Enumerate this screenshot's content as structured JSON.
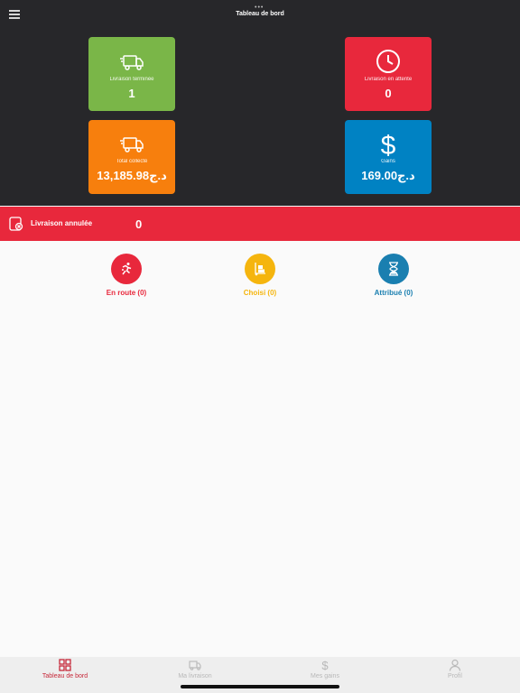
{
  "header": {
    "title": "Tableau de bord",
    "menu_icon": "hamburger-icon",
    "dots": "•••"
  },
  "cards": {
    "completed": {
      "label": "Livraison terminée",
      "value": "1",
      "color": "#7ab648",
      "icon": "delivery-truck-icon"
    },
    "pending": {
      "label": "Livraison en attente",
      "value": "0",
      "color": "#e8283c",
      "icon": "clock-icon"
    },
    "collected": {
      "label": "Total collecté",
      "value": "13,185.98د.ج",
      "color": "#f77f0d",
      "icon": "delivery-truck-icon"
    },
    "earnings": {
      "label": "Gains",
      "value": "169.00د.ج",
      "color": "#0082c3",
      "icon": "dollar-icon"
    }
  },
  "cancelled": {
    "label": "Livraison annulée",
    "value": "0",
    "color": "#e8283c",
    "icon": "cancel-box-icon"
  },
  "statuses": {
    "en_route": {
      "label": "En route (0)",
      "color": "#e8283c",
      "icon": "running-person-icon"
    },
    "choisi": {
      "label": "Choisi (0)",
      "color": "#f5b50e",
      "icon": "hand-truck-icon"
    },
    "attribue": {
      "label": "Attribué (0)",
      "color": "#1a7fb0",
      "icon": "hourglass-icon"
    }
  },
  "nav": {
    "items": [
      {
        "label": "Tableau de bord",
        "icon": "dashboard-grid-icon",
        "active": true
      },
      {
        "label": "Ma livraison",
        "icon": "truck-icon",
        "active": false
      },
      {
        "label": "Mes gains",
        "icon": "dollar-icon",
        "active": false
      },
      {
        "label": "Profil",
        "icon": "user-icon",
        "active": false
      }
    ],
    "active_color": "#c62839"
  }
}
